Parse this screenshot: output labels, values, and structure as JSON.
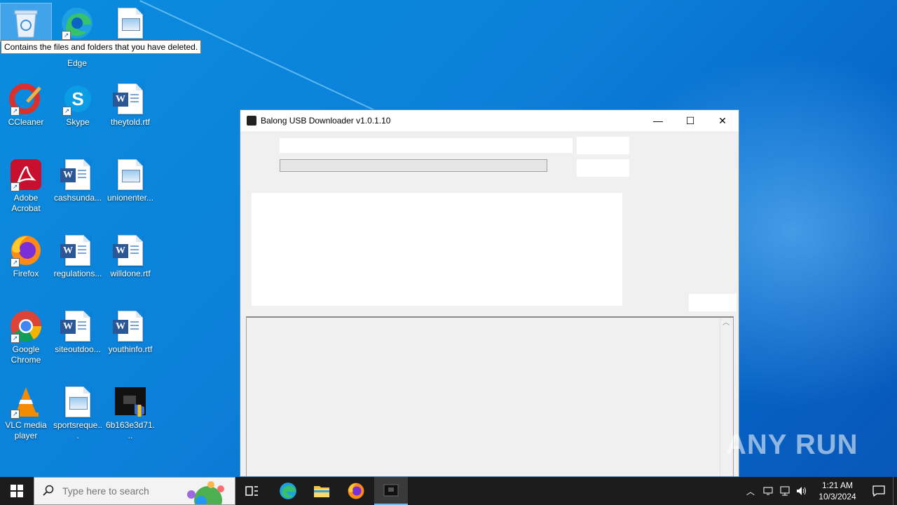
{
  "desktop": {
    "tooltip": "Contains the files and folders that you have deleted.",
    "icons": [
      {
        "label": "Recycle Bin",
        "kind": "recycle-bin-icon"
      },
      {
        "label": "Edge",
        "kind": "edge-icon"
      },
      {
        "label": "",
        "kind": "image-file-icon"
      },
      {
        "label": "CCleaner",
        "kind": "ccleaner-icon"
      },
      {
        "label": "Skype",
        "kind": "skype-icon"
      },
      {
        "label": "theytold.rtf",
        "kind": "word-doc-icon"
      },
      {
        "label": "Adobe Acrobat",
        "kind": "acrobat-icon"
      },
      {
        "label": "cashsunda...",
        "kind": "word-doc-icon"
      },
      {
        "label": "unionenter...",
        "kind": "image-file-icon"
      },
      {
        "label": "Firefox",
        "kind": "firefox-icon"
      },
      {
        "label": "regulations...",
        "kind": "word-doc-icon"
      },
      {
        "label": "willdone.rtf",
        "kind": "word-doc-icon"
      },
      {
        "label": "Google Chrome",
        "kind": "chrome-icon"
      },
      {
        "label": "siteoutdoo...",
        "kind": "word-doc-icon"
      },
      {
        "label": "youthinfo.rtf",
        "kind": "word-doc-icon"
      },
      {
        "label": "VLC media player",
        "kind": "vlc-icon"
      },
      {
        "label": "sportsreque...",
        "kind": "image-file-icon"
      },
      {
        "label": "6b163e3d71...",
        "kind": "exe-file-icon"
      }
    ]
  },
  "window": {
    "title": "Balong USB Downloader v1.0.1.10",
    "minimize_symbol": "—",
    "maximize_symbol": "☐",
    "close_symbol": "✕",
    "progress_percent": 0
  },
  "taskbar": {
    "search_placeholder": "Type here to search",
    "pinned": [
      "task-view-icon",
      "edge-icon",
      "file-explorer-icon",
      "firefox-icon",
      "balong-app-icon"
    ],
    "clock_time": "1:21 AM",
    "clock_date": "10/3/2024"
  },
  "watermark": "ANY RUN"
}
